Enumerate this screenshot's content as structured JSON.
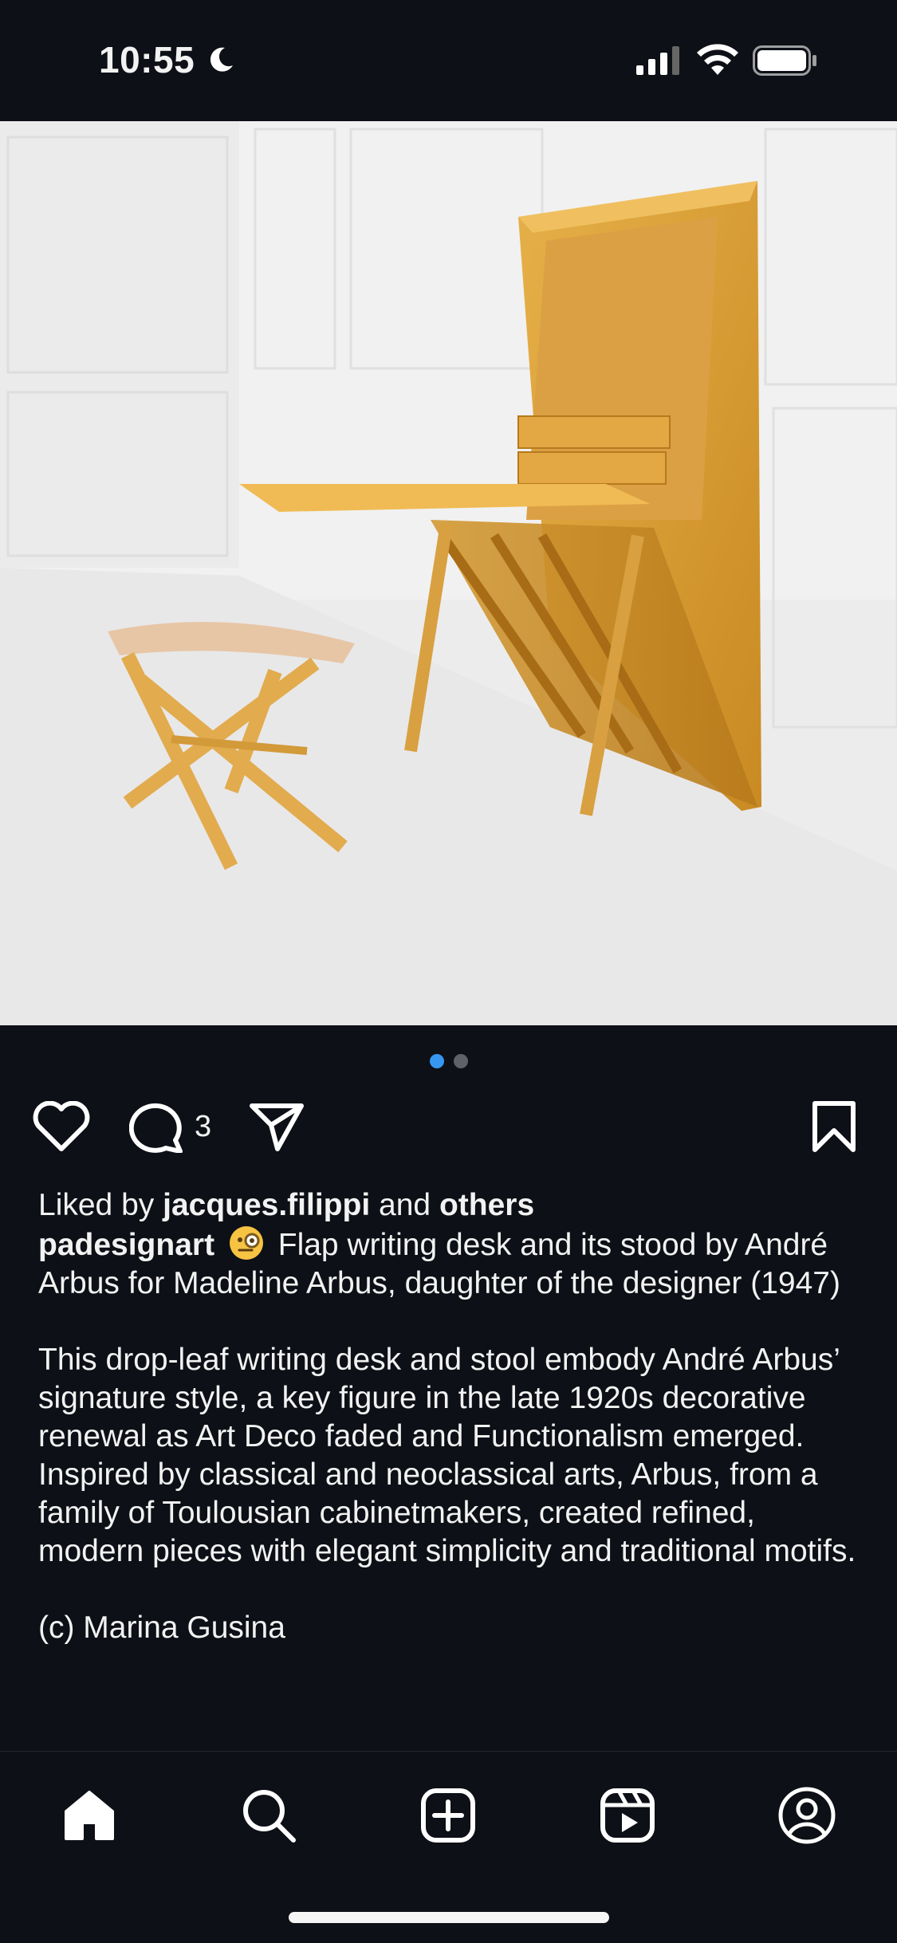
{
  "status_bar": {
    "time": "10:55",
    "icons": [
      "moon-icon",
      "signal-icon",
      "wifi-icon",
      "battery-icon"
    ]
  },
  "post": {
    "image_alt": "Flap writing desk and stool",
    "carousel": {
      "count": 2,
      "active_index": 0
    },
    "actions": {
      "like_icon": "heart-icon",
      "comment_icon": "comment-icon",
      "comment_count": "3",
      "share_icon": "paper-plane-icon",
      "save_icon": "bookmark-icon"
    },
    "liked_by": {
      "prefix": "Liked by",
      "user": "jacques.filippi",
      "joiner": "and",
      "others": "others"
    },
    "caption": {
      "username": "padesignart",
      "emoji": "face-with-monocle-emoji",
      "text": "Flap writing desk and its stood by André Arbus for Madeline Arbus, daughter of the designer (1947)",
      "body": "This drop-leaf writing desk and stool embody André Arbus’ signature style, a key figure in the late 1920s decorative renewal as Art Deco faded and Functionalism emerged. Inspired by classical and neoclassical arts, Arbus, from a family of Toulousian cabinetmakers, created refined, modern pieces with elegant simplicity and traditional motifs.",
      "credit": "(c) Marina Gusina"
    }
  },
  "tab_bar": {
    "items": [
      "home-icon",
      "search-icon",
      "create-icon",
      "reels-icon",
      "profile-icon"
    ]
  },
  "colors": {
    "background": "#0d1016",
    "text": "#f2f2f2",
    "accent": "#3797f0",
    "inactive_dot": "#5e6268"
  }
}
